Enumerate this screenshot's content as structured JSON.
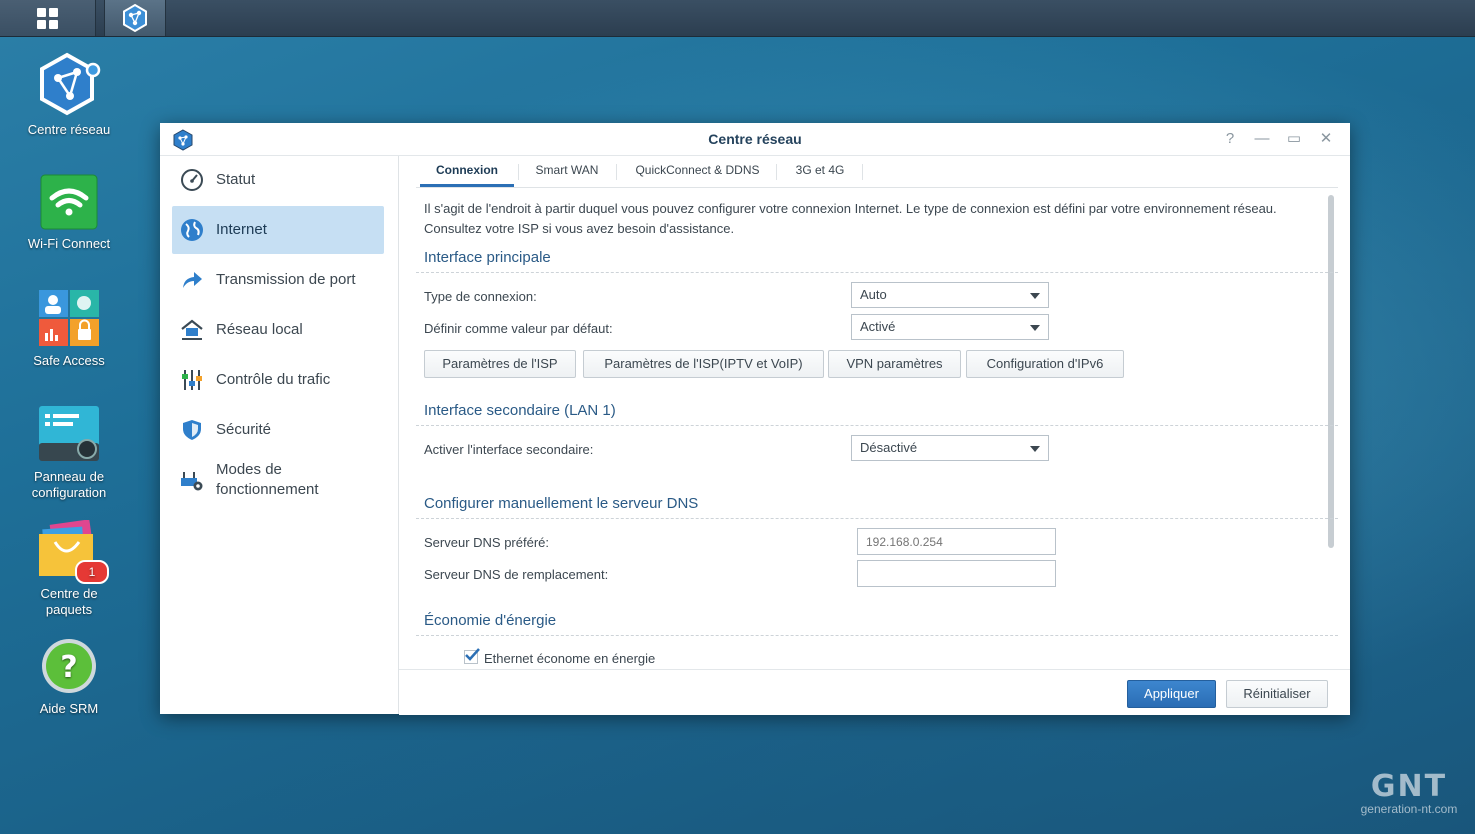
{
  "taskbar": {
    "main_menu_icon": "grid-icon",
    "open_app_icon": "network-center-icon"
  },
  "desktop": {
    "icons": [
      {
        "label": "Centre réseau",
        "icon": "network-center-icon"
      },
      {
        "label": "Wi-Fi Connect",
        "icon": "wifi-icon"
      },
      {
        "label": "Safe Access",
        "icon": "safe-access-icon"
      },
      {
        "label": "Panneau de configuration",
        "icon": "control-panel-icon"
      },
      {
        "label": "Centre de paquets",
        "icon": "package-center-icon",
        "badge": "1"
      },
      {
        "label": "Aide SRM",
        "icon": "help-icon"
      }
    ]
  },
  "window": {
    "title": "Centre réseau",
    "controls": {
      "help": "?",
      "minimize": "—",
      "maximize": "▭",
      "close": "✕"
    },
    "sidebar": {
      "items": [
        {
          "label": "Statut",
          "icon": "speedometer-icon",
          "active": false
        },
        {
          "label": "Internet",
          "icon": "globe-icon",
          "active": true
        },
        {
          "label": "Transmission de port",
          "icon": "forward-arrow-icon",
          "active": false
        },
        {
          "label": "Réseau local",
          "icon": "home-network-icon",
          "active": false
        },
        {
          "label": "Contrôle du trafic",
          "icon": "sliders-icon",
          "active": false
        },
        {
          "label": "Sécurité",
          "icon": "shield-icon",
          "active": false
        },
        {
          "label": "Modes de fonctionnement",
          "icon": "router-gear-icon",
          "active": false
        }
      ]
    },
    "tabs": [
      {
        "label": "Connexion",
        "active": true
      },
      {
        "label": "Smart WAN",
        "active": false
      },
      {
        "label": "QuickConnect & DDNS",
        "active": false
      },
      {
        "label": "3G et 4G",
        "active": false
      }
    ],
    "content": {
      "intro": "Il s'agit de l'endroit à partir duquel vous pouvez configurer votre connexion Internet. Le type de connexion est défini par votre environnement réseau. Consultez votre ISP si vous avez besoin d'assistance.",
      "primary": {
        "title": "Interface principale",
        "connection_type_label": "Type de connexion:",
        "connection_type_value": "Auto",
        "default_label": "Définir comme valeur par défaut:",
        "default_value": "Activé",
        "buttons": {
          "isp": "Paramètres de l'ISP",
          "isp_iptv": "Paramètres de l'ISP(IPTV et VoIP)",
          "vpn": "VPN paramètres",
          "ipv6": "Configuration d'IPv6"
        }
      },
      "secondary": {
        "title": "Interface secondaire (LAN 1)",
        "enable_label": "Activer l'interface secondaire:",
        "enable_value": "Désactivé"
      },
      "dns": {
        "title": "Configurer manuellement le serveur DNS",
        "preferred_label": "Serveur DNS préféré:",
        "preferred_placeholder": "192.168.0.254",
        "alternate_label": "Serveur DNS de remplacement:",
        "alternate_value": ""
      },
      "energy": {
        "title": "Économie d'énergie",
        "checkbox_label": "Ethernet économe en énergie",
        "checked": true
      }
    },
    "footer": {
      "apply": "Appliquer",
      "reset": "Réinitialiser"
    }
  },
  "watermark": {
    "brand": "GNT",
    "site": "generation-nt.com"
  },
  "colors": {
    "accent": "#2b6fb5",
    "active_sidebar": "#c6dff3",
    "section_title": "#2a5a86"
  }
}
